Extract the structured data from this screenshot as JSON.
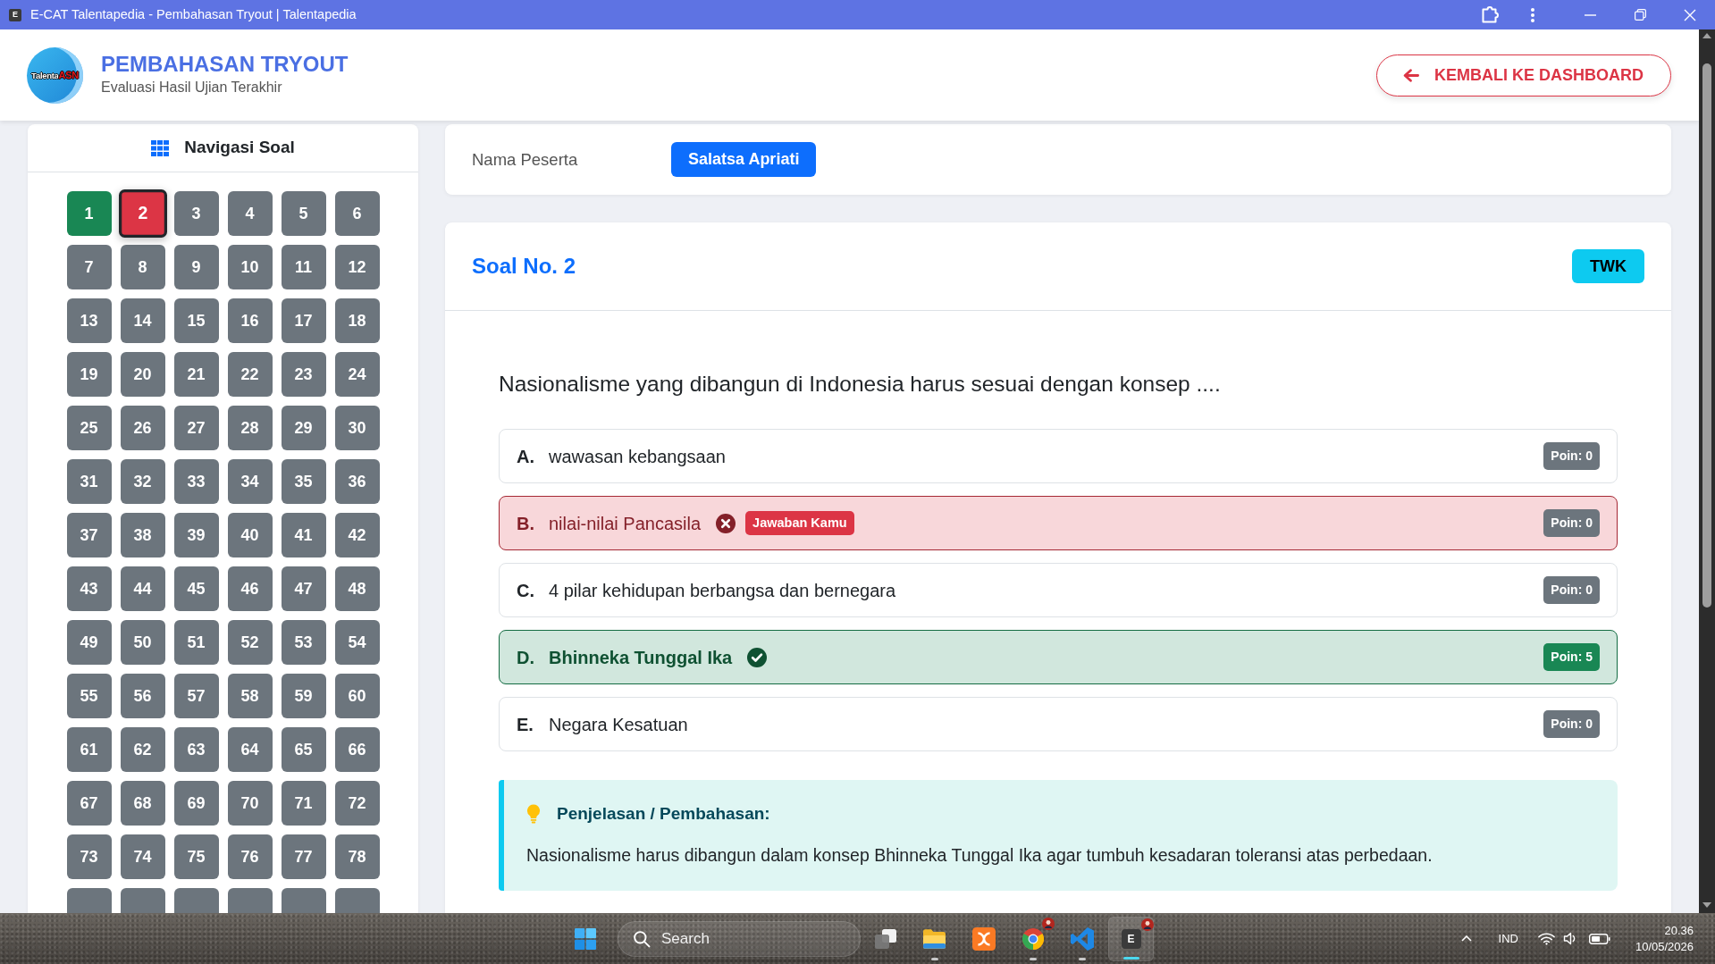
{
  "window": {
    "favicon": "E",
    "title": "E-CAT Talentapedia - Pembahasan Tryout | Talentapedia"
  },
  "header": {
    "logo": {
      "text": "Talenta",
      "accent": "ASN"
    },
    "title": "PEMBAHASAN TRYOUT",
    "subtitle": "Evaluasi Hasil Ujian Terakhir",
    "back_button": "KEMBALI KE DASHBOARD"
  },
  "navigation": {
    "title": "Navigasi Soal",
    "items": [
      {
        "label": "1",
        "kind": "correct",
        "selected": false
      },
      {
        "label": "2",
        "kind": "wrong",
        "selected": true
      },
      {
        "label": "3",
        "kind": "neutral",
        "selected": false
      },
      {
        "label": "4",
        "kind": "neutral",
        "selected": false
      },
      {
        "label": "5",
        "kind": "neutral",
        "selected": false
      },
      {
        "label": "6",
        "kind": "neutral",
        "selected": false
      },
      {
        "label": "7",
        "kind": "neutral",
        "selected": false
      },
      {
        "label": "8",
        "kind": "neutral",
        "selected": false
      },
      {
        "label": "9",
        "kind": "neutral",
        "selected": false
      },
      {
        "label": "10",
        "kind": "neutral",
        "selected": false
      },
      {
        "label": "11",
        "kind": "neutral",
        "selected": false
      },
      {
        "label": "12",
        "kind": "neutral",
        "selected": false
      },
      {
        "label": "13",
        "kind": "neutral",
        "selected": false
      },
      {
        "label": "14",
        "kind": "neutral",
        "selected": false
      },
      {
        "label": "15",
        "kind": "neutral",
        "selected": false
      },
      {
        "label": "16",
        "kind": "neutral",
        "selected": false
      },
      {
        "label": "17",
        "kind": "neutral",
        "selected": false
      },
      {
        "label": "18",
        "kind": "neutral",
        "selected": false
      },
      {
        "label": "19",
        "kind": "neutral",
        "selected": false
      },
      {
        "label": "20",
        "kind": "neutral",
        "selected": false
      },
      {
        "label": "21",
        "kind": "neutral",
        "selected": false
      },
      {
        "label": "22",
        "kind": "neutral",
        "selected": false
      },
      {
        "label": "23",
        "kind": "neutral",
        "selected": false
      },
      {
        "label": "24",
        "kind": "neutral",
        "selected": false
      },
      {
        "label": "25",
        "kind": "neutral",
        "selected": false
      },
      {
        "label": "26",
        "kind": "neutral",
        "selected": false
      },
      {
        "label": "27",
        "kind": "neutral",
        "selected": false
      },
      {
        "label": "28",
        "kind": "neutral",
        "selected": false
      },
      {
        "label": "29",
        "kind": "neutral",
        "selected": false
      },
      {
        "label": "30",
        "kind": "neutral",
        "selected": false
      },
      {
        "label": "31",
        "kind": "neutral",
        "selected": false
      },
      {
        "label": "32",
        "kind": "neutral",
        "selected": false
      },
      {
        "label": "33",
        "kind": "neutral",
        "selected": false
      },
      {
        "label": "34",
        "kind": "neutral",
        "selected": false
      },
      {
        "label": "35",
        "kind": "neutral",
        "selected": false
      },
      {
        "label": "36",
        "kind": "neutral",
        "selected": false
      },
      {
        "label": "37",
        "kind": "neutral",
        "selected": false
      },
      {
        "label": "38",
        "kind": "neutral",
        "selected": false
      },
      {
        "label": "39",
        "kind": "neutral",
        "selected": false
      },
      {
        "label": "40",
        "kind": "neutral",
        "selected": false
      },
      {
        "label": "41",
        "kind": "neutral",
        "selected": false
      },
      {
        "label": "42",
        "kind": "neutral",
        "selected": false
      },
      {
        "label": "43",
        "kind": "neutral",
        "selected": false
      },
      {
        "label": "44",
        "kind": "neutral",
        "selected": false
      },
      {
        "label": "45",
        "kind": "neutral",
        "selected": false
      },
      {
        "label": "46",
        "kind": "neutral",
        "selected": false
      },
      {
        "label": "47",
        "kind": "neutral",
        "selected": false
      },
      {
        "label": "48",
        "kind": "neutral",
        "selected": false
      },
      {
        "label": "49",
        "kind": "neutral",
        "selected": false
      },
      {
        "label": "50",
        "kind": "neutral",
        "selected": false
      },
      {
        "label": "51",
        "kind": "neutral",
        "selected": false
      },
      {
        "label": "52",
        "kind": "neutral",
        "selected": false
      },
      {
        "label": "53",
        "kind": "neutral",
        "selected": false
      },
      {
        "label": "54",
        "kind": "neutral",
        "selected": false
      },
      {
        "label": "55",
        "kind": "neutral",
        "selected": false
      },
      {
        "label": "56",
        "kind": "neutral",
        "selected": false
      },
      {
        "label": "57",
        "kind": "neutral",
        "selected": false
      },
      {
        "label": "58",
        "kind": "neutral",
        "selected": false
      },
      {
        "label": "59",
        "kind": "neutral",
        "selected": false
      },
      {
        "label": "60",
        "kind": "neutral",
        "selected": false
      },
      {
        "label": "61",
        "kind": "neutral",
        "selected": false
      },
      {
        "label": "62",
        "kind": "neutral",
        "selected": false
      },
      {
        "label": "63",
        "kind": "neutral",
        "selected": false
      },
      {
        "label": "64",
        "kind": "neutral",
        "selected": false
      },
      {
        "label": "65",
        "kind": "neutral",
        "selected": false
      },
      {
        "label": "66",
        "kind": "neutral",
        "selected": false
      },
      {
        "label": "67",
        "kind": "neutral",
        "selected": false
      },
      {
        "label": "68",
        "kind": "neutral",
        "selected": false
      },
      {
        "label": "69",
        "kind": "neutral",
        "selected": false
      },
      {
        "label": "70",
        "kind": "neutral",
        "selected": false
      },
      {
        "label": "71",
        "kind": "neutral",
        "selected": false
      },
      {
        "label": "72",
        "kind": "neutral",
        "selected": false
      },
      {
        "label": "73",
        "kind": "neutral",
        "selected": false
      },
      {
        "label": "74",
        "kind": "neutral",
        "selected": false
      },
      {
        "label": "75",
        "kind": "neutral",
        "selected": false
      },
      {
        "label": "76",
        "kind": "neutral",
        "selected": false
      },
      {
        "label": "77",
        "kind": "neutral",
        "selected": false
      },
      {
        "label": "78",
        "kind": "neutral",
        "selected": false
      },
      {
        "kind": "neutral",
        "selected": false
      },
      {
        "kind": "neutral",
        "selected": false
      },
      {
        "kind": "neutral",
        "selected": false
      },
      {
        "kind": "neutral",
        "selected": false
      },
      {
        "kind": "neutral",
        "selected": false
      },
      {
        "kind": "neutral",
        "selected": false
      }
    ]
  },
  "participant": {
    "label": "Nama Peserta",
    "name": "Salatsa Apriati"
  },
  "question": {
    "title": "Soal No. 2",
    "category": "TWK",
    "text": "Nasionalisme yang dibangun di Indonesia harus sesuai dengan konsep ....",
    "options": [
      {
        "letter": "A.",
        "text": "wawasan kebangsaan",
        "points": "Poin: 0",
        "kind": "plain"
      },
      {
        "letter": "B.",
        "text": "nilai-nilai Pancasila",
        "points": "Poin: 0",
        "kind": "wrong",
        "badge": "Jawaban Kamu"
      },
      {
        "letter": "C.",
        "text": "4 pilar kehidupan berbangsa dan bernegara",
        "points": "Poin: 0",
        "kind": "plain"
      },
      {
        "letter": "D.",
        "text": "Bhinneka Tunggal Ika",
        "points": "Poin: 5",
        "kind": "correct"
      },
      {
        "letter": "E.",
        "text": "Negara Kesatuan",
        "points": "Poin: 0",
        "kind": "plain"
      }
    ],
    "explanation": {
      "title": "Penjelasan / Pembahasan:",
      "text": "Nasionalisme harus dibangun dalam konsep Bhinneka Tunggal Ika agar tumbuh kesadaran toleransi atas perbedaan."
    }
  },
  "taskbar": {
    "search": {
      "placeholder": "Search"
    },
    "apps": [
      {
        "kind": "window",
        "running": false,
        "active": false,
        "profile_badge": false
      },
      {
        "kind": "folder",
        "running": true,
        "active": false,
        "profile_badge": false
      },
      {
        "kind": "server",
        "running": false,
        "active": false,
        "profile_badge": false
      },
      {
        "kind": "browser",
        "running": true,
        "active": false,
        "profile_badge": true
      },
      {
        "kind": "editor",
        "running": true,
        "active": false,
        "profile_badge": false
      },
      {
        "kind": "letter",
        "letter": "E",
        "running": true,
        "active": true,
        "profile_badge": true
      }
    ],
    "language": "IND",
    "time": "20.36",
    "date": "10/05/2026"
  }
}
